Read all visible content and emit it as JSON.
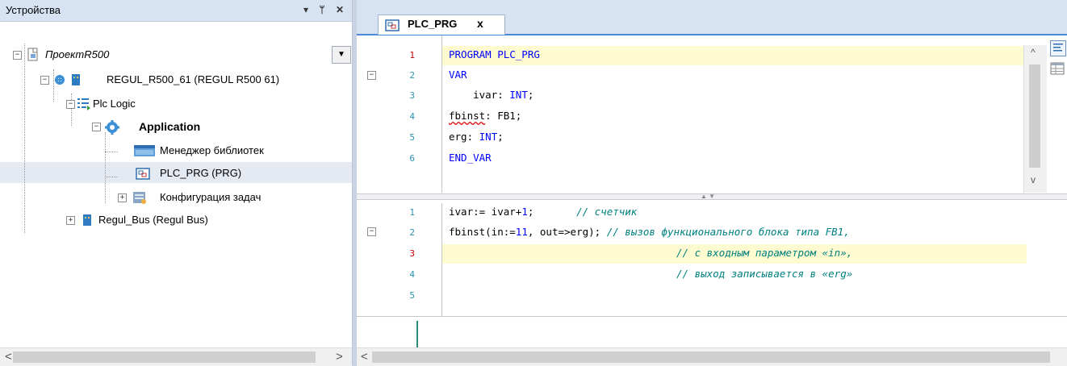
{
  "devices_panel": {
    "title": "Устройства",
    "controls": {
      "dropdown": "▾",
      "pin": "ᛘ",
      "close": "✕"
    },
    "tree": [
      {
        "label": "ПроектR500",
        "italic": true,
        "expander": "−",
        "icon": "project-file-icon"
      },
      {
        "label": "REGUL_R500_61 (REGUL R500 61)",
        "expander": "−",
        "icon": "plc-device-icon"
      },
      {
        "label": "Plc Logic",
        "expander": "−",
        "icon": "plc-logic-icon"
      },
      {
        "label": "Application",
        "bold": true,
        "expander": "−",
        "icon": "application-gear-icon"
      },
      {
        "label": "Менеджер библиотек",
        "icon": "library-manager-icon"
      },
      {
        "label": "PLC_PRG (PRG)",
        "selected": true,
        "icon": "pou-icon"
      },
      {
        "label": "Конфигурация задач",
        "expander": "+",
        "icon": "task-config-icon"
      },
      {
        "label": "Regul_Bus (Regul Bus)",
        "expander": "+",
        "icon": "bus-device-icon"
      }
    ],
    "scroll": {
      "left": "<",
      "right": ">"
    }
  },
  "editor": {
    "tab": {
      "label": "PLC_PRG",
      "close": "x"
    },
    "declaration": {
      "line_numbers": [
        "1",
        "2",
        "3",
        "4",
        "5",
        "6"
      ],
      "lines": {
        "l1": "PROGRAM PLC_PRG",
        "l2": "VAR",
        "l3a": "    ivar: ",
        "l3b": "INT",
        "l3c": ";",
        "l4a": "fbinst",
        "l4b": ": FB1;",
        "l5a": "erg: ",
        "l5b": "INT",
        "l5c": ";",
        "l6": "END_VAR"
      },
      "fold": "−"
    },
    "implementation": {
      "line_numbers": [
        "1",
        "2",
        "3",
        "4",
        "5"
      ],
      "lines": {
        "l1a": "ivar:= ivar+",
        "l1b": "1",
        "l1c": ";       ",
        "l1d": "// счетчик",
        "l2a": "fbinst(in:=",
        "l2b": "11",
        "l2c": ", out=>erg); ",
        "l2d": "// вызов функционального блока типа FB1,",
        "l3": "// с входным параметром «in»,",
        "l4": "// выход записывается в «erg»"
      },
      "fold": "−"
    },
    "scroll": {
      "left": "<",
      "up": "^",
      "down": "v"
    }
  },
  "colors": {
    "keyword": "#0000ff",
    "comment": "#008080",
    "highlight": "#fffbd0",
    "header": "#d7e2f2"
  }
}
